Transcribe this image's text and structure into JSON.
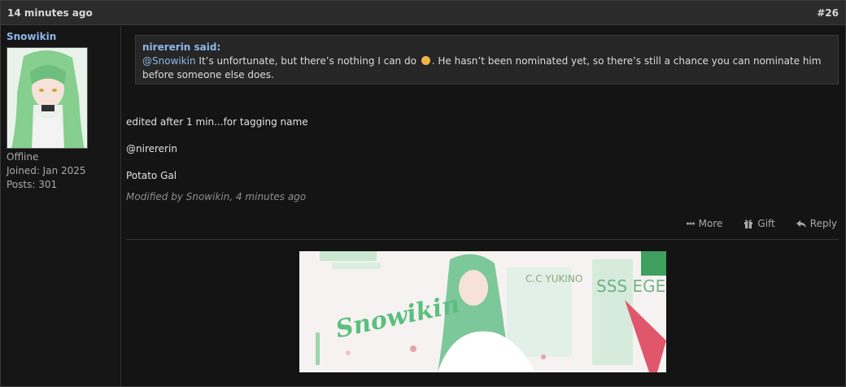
{
  "post": {
    "time": "14 minutes ago",
    "number": "#26"
  },
  "user": {
    "name": "Snowikin",
    "status": "Offline",
    "joined": "Joined: Jan 2025",
    "posts": "Posts: 301"
  },
  "quote": {
    "author": "nirererin said:",
    "mention": "@Snowikin",
    "text_before_emoji": " It’s unfortunate, but there’s nothing I can do ",
    "text_after_emoji": ". He hasn’t been nominated yet, so there’s still a chance you can nominate him before someone else does."
  },
  "body": {
    "line1": "edited after 1 min...for tagging name",
    "mention": "@nirererin",
    "link": "Potato Gal",
    "modified": "Modified by Snowikin, 4 minutes ago"
  },
  "actions": {
    "more": "More",
    "gift": "Gift",
    "reply": "Reply"
  },
  "signature": {
    "banner_name": "Snowikin",
    "banner_top_text": "C.C YUKINO",
    "banner_side_text": "SSS EGE USS"
  },
  "colors": {
    "accent": "#8fb6e8",
    "banner_green": "#7cc89a",
    "banner_red": "#e0566a"
  }
}
